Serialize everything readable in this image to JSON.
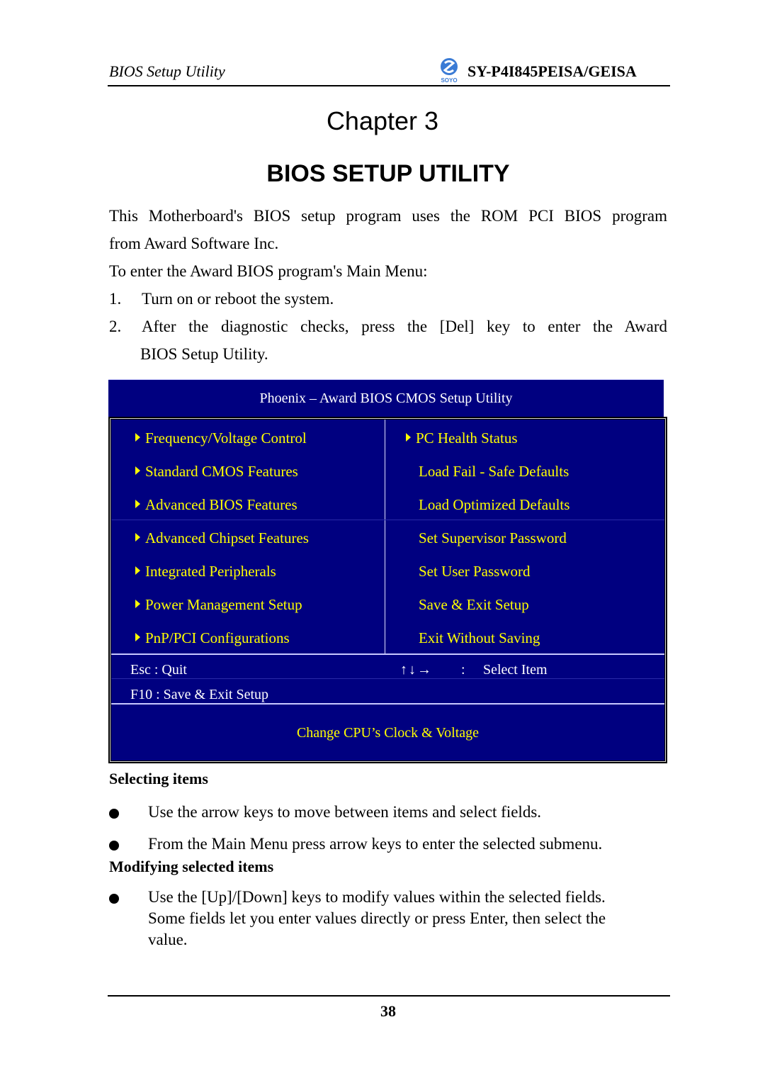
{
  "running_header": {
    "left": "BIOS Setup Utility",
    "logo": "soyo-logo-icon",
    "logo_text": "SOYO",
    "right": "SY-P4I845PEISA/GEISA"
  },
  "chapter": "Chapter 3",
  "title": "BIOS SETUP UTILITY",
  "intro": {
    "line1": "This Motherboard's BIOS setup program uses the ROM PCI BIOS program",
    "line2": "from Award Software Inc.",
    "line3": "To enter the Award BIOS program's Main Menu:",
    "steps": [
      {
        "num": "1.",
        "text": "Turn on or reboot the system."
      },
      {
        "num": "2.",
        "text": "After the diagnostic checks, press the [Del] key to enter the Award",
        "text2": "BIOS Setup Utility."
      }
    ]
  },
  "bios_screen": {
    "title": "Phoenix – Award BIOS CMOS Setup Utility",
    "left_menu": [
      {
        "label": "Frequency/Voltage Control",
        "submenu": true
      },
      {
        "label": "Standard CMOS Features",
        "submenu": true
      },
      {
        "label": "Advanced BIOS Features",
        "submenu": true
      },
      {
        "label": "Advanced Chipset Features",
        "submenu": true
      },
      {
        "label": "Integrated Peripherals",
        "submenu": true
      },
      {
        "label": "Power Management Setup",
        "submenu": true
      },
      {
        "label": "PnP/PCI Configurations",
        "submenu": true
      }
    ],
    "right_menu": [
      {
        "label": "PC Health Status",
        "submenu": true
      },
      {
        "label": "Load Fail - Safe Defaults",
        "submenu": false
      },
      {
        "label": "Load Optimized Defaults",
        "submenu": false
      },
      {
        "label": "Set Supervisor Password",
        "submenu": false
      },
      {
        "label": "Set User Password",
        "submenu": false
      },
      {
        "label": "Save & Exit Setup",
        "submenu": false
      },
      {
        "label": "Exit Without Saving",
        "submenu": false
      }
    ],
    "keys": {
      "esc": "Esc : Quit",
      "arrows": "↑↓→",
      "colon": ":",
      "select": "Select Item",
      "f10": "F10 : Save & Exit Setup"
    },
    "help": "Change CPU’s Clock & Voltage",
    "colors": {
      "background": "#000080",
      "menu_text": "#ffff00",
      "key_text": "#ffffff"
    }
  },
  "sections": {
    "selecting": {
      "heading": "Selecting items",
      "bullets": [
        "Use the arrow keys to move between items and select fields.",
        "From the Main Menu press arrow keys to enter the selected submenu."
      ]
    },
    "modifying": {
      "heading": "Modifying selected items",
      "bullets": [
        {
          "line1": "Use the [Up]/[Down] keys to modify values within the selected fields.",
          "line2": "Some fields let you enter values directly or press Enter, then select the",
          "line3": "value."
        }
      ]
    }
  },
  "page_number": "38"
}
